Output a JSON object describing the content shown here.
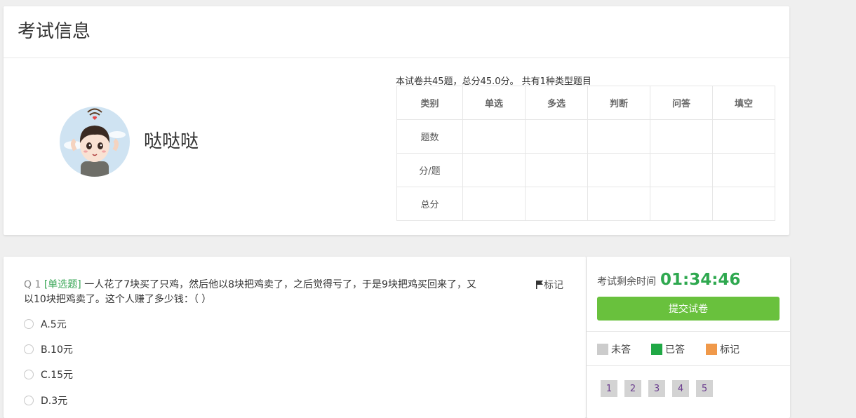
{
  "header": {
    "title": "考试信息"
  },
  "user": {
    "name": "哒哒哒"
  },
  "exam": {
    "summary": "本试卷共45题，总分45.0分。 共有1种类型题目",
    "table": {
      "headers": [
        "类别",
        "单选",
        "多选",
        "判断",
        "问答",
        "填空"
      ],
      "rows": [
        [
          "题数",
          "",
          "",
          "",
          "",
          ""
        ],
        [
          "分/题",
          "",
          "",
          "",
          "",
          ""
        ],
        [
          "总分",
          "",
          "",
          "",
          "",
          ""
        ]
      ]
    }
  },
  "question": {
    "number": "Q 1",
    "type": "[单选题]",
    "text": "一人花了7块买了只鸡，然后他以8块把鸡卖了，之后觉得亏了，于是9块把鸡买回来了，又以10块把鸡卖了。这个人赚了多少钱：（ ）",
    "mark_label": "标记",
    "options": [
      "A.5元",
      "B.10元",
      "C.15元",
      "D.3元"
    ]
  },
  "side": {
    "timer_label": "考试剩余时间",
    "timer_value": "01:34:46",
    "submit_label": "提交试卷",
    "legend": [
      {
        "label": "未答",
        "color": "#cccccc"
      },
      {
        "label": "已答",
        "color": "#20a845"
      },
      {
        "label": "标记",
        "color": "#f0994a"
      }
    ],
    "question_numbers": [
      "1",
      "2",
      "3",
      "4",
      "5"
    ]
  }
}
